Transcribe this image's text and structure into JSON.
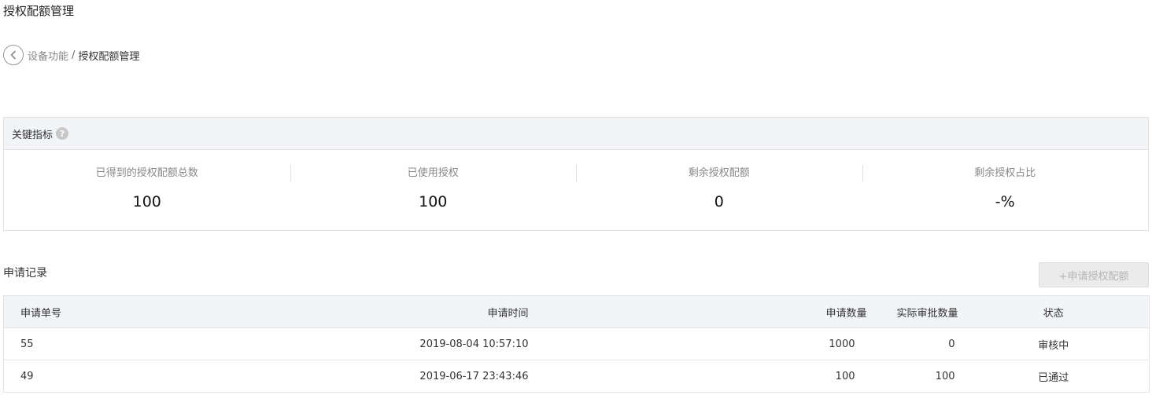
{
  "page": {
    "title": "授权配额管理"
  },
  "breadcrumb": {
    "parent": "设备功能",
    "separator": "/",
    "current": "授权配额管理"
  },
  "metrics": {
    "title": "关键指标",
    "help_glyph": "?",
    "items": [
      {
        "label": "已得到的授权配额总数",
        "value": "100"
      },
      {
        "label": "已使用授权",
        "value": "100"
      },
      {
        "label": "剩余授权配额",
        "value": "0"
      },
      {
        "label": "剩余授权占比",
        "value": "-%"
      }
    ]
  },
  "records": {
    "title": "申请记录",
    "apply_button": "+申请授权配额",
    "columns": [
      "申请单号",
      "申请时间",
      "申请数量",
      "实际审批数量",
      "状态"
    ],
    "rows": [
      {
        "id": "55",
        "time": "2019-08-04 10:57:10",
        "qty": "1000",
        "approved": "0",
        "status": "审核中"
      },
      {
        "id": "49",
        "time": "2019-06-17 23:43:46",
        "qty": "100",
        "approved": "100",
        "status": "已通过"
      }
    ]
  },
  "colors": {
    "header_bg": "#f2f4f7",
    "border": "#e3e3e3",
    "disabled_button_bg": "#ebebeb"
  },
  "icons": {
    "back": "chevron-left-circle-icon",
    "help": "question-circle-icon"
  }
}
